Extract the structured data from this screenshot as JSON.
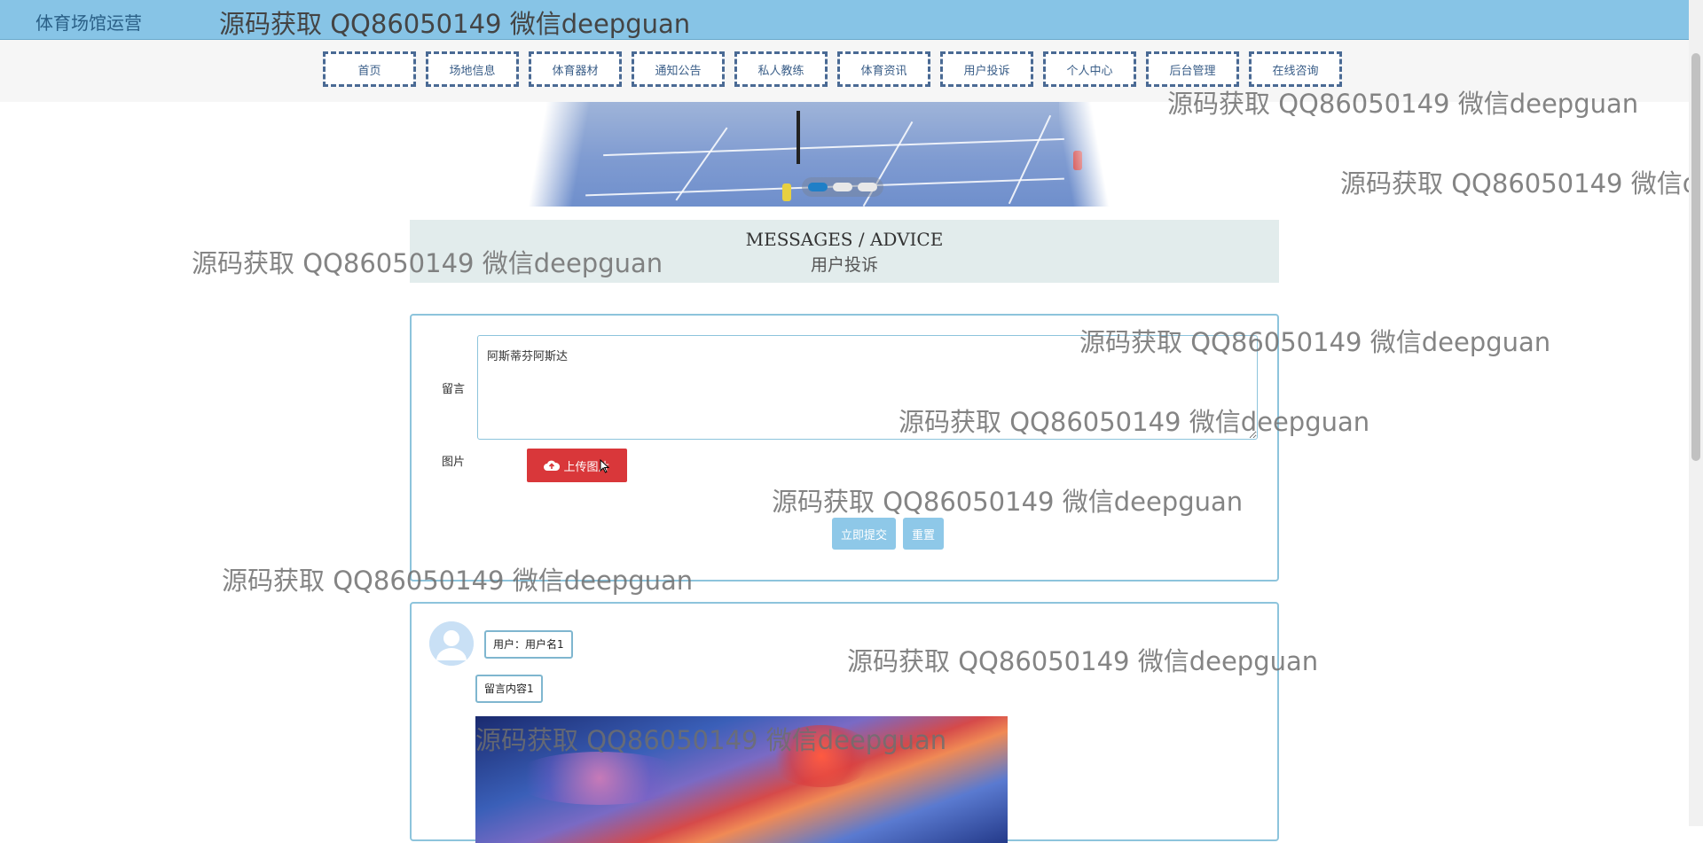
{
  "header": {
    "site_title": "体育场馆运营"
  },
  "nav": {
    "items": [
      "首页",
      "场地信息",
      "体育器材",
      "通知公告",
      "私人教练",
      "体育资讯",
      "用户投诉",
      "个人中心",
      "后台管理",
      "在线咨询"
    ]
  },
  "section": {
    "title_en": "MESSAGES / ADVICE",
    "title_cn": "用户投诉"
  },
  "form": {
    "message_label": "留言",
    "message_value": "阿斯蒂芬阿斯达",
    "image_label": "图片",
    "upload_label": "上传图片",
    "submit_label": "立即提交",
    "reset_label": "重置"
  },
  "comment": {
    "user": "用户：用户名1",
    "content": "留言内容1"
  },
  "watermark": "源码获取 QQ86050149 微信deepguan",
  "slider": {
    "count": 3,
    "active_index": 0
  },
  "colors": {
    "header": "#87c4e6",
    "upload": "#d9373a",
    "light_button": "#8ec8e8",
    "border": "#8dc4dc"
  }
}
